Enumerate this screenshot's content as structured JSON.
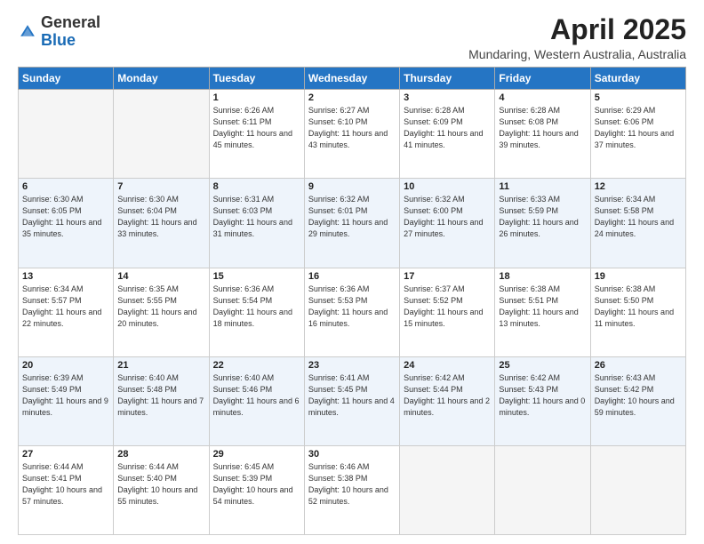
{
  "logo": {
    "general": "General",
    "blue": "Blue"
  },
  "header": {
    "month": "April 2025",
    "location": "Mundaring, Western Australia, Australia"
  },
  "weekdays": [
    "Sunday",
    "Monday",
    "Tuesday",
    "Wednesday",
    "Thursday",
    "Friday",
    "Saturday"
  ],
  "weeks": [
    [
      {
        "day": "",
        "info": ""
      },
      {
        "day": "",
        "info": ""
      },
      {
        "day": "1",
        "info": "Sunrise: 6:26 AM\nSunset: 6:11 PM\nDaylight: 11 hours and 45 minutes."
      },
      {
        "day": "2",
        "info": "Sunrise: 6:27 AM\nSunset: 6:10 PM\nDaylight: 11 hours and 43 minutes."
      },
      {
        "day": "3",
        "info": "Sunrise: 6:28 AM\nSunset: 6:09 PM\nDaylight: 11 hours and 41 minutes."
      },
      {
        "day": "4",
        "info": "Sunrise: 6:28 AM\nSunset: 6:08 PM\nDaylight: 11 hours and 39 minutes."
      },
      {
        "day": "5",
        "info": "Sunrise: 6:29 AM\nSunset: 6:06 PM\nDaylight: 11 hours and 37 minutes."
      }
    ],
    [
      {
        "day": "6",
        "info": "Sunrise: 6:30 AM\nSunset: 6:05 PM\nDaylight: 11 hours and 35 minutes."
      },
      {
        "day": "7",
        "info": "Sunrise: 6:30 AM\nSunset: 6:04 PM\nDaylight: 11 hours and 33 minutes."
      },
      {
        "day": "8",
        "info": "Sunrise: 6:31 AM\nSunset: 6:03 PM\nDaylight: 11 hours and 31 minutes."
      },
      {
        "day": "9",
        "info": "Sunrise: 6:32 AM\nSunset: 6:01 PM\nDaylight: 11 hours and 29 minutes."
      },
      {
        "day": "10",
        "info": "Sunrise: 6:32 AM\nSunset: 6:00 PM\nDaylight: 11 hours and 27 minutes."
      },
      {
        "day": "11",
        "info": "Sunrise: 6:33 AM\nSunset: 5:59 PM\nDaylight: 11 hours and 26 minutes."
      },
      {
        "day": "12",
        "info": "Sunrise: 6:34 AM\nSunset: 5:58 PM\nDaylight: 11 hours and 24 minutes."
      }
    ],
    [
      {
        "day": "13",
        "info": "Sunrise: 6:34 AM\nSunset: 5:57 PM\nDaylight: 11 hours and 22 minutes."
      },
      {
        "day": "14",
        "info": "Sunrise: 6:35 AM\nSunset: 5:55 PM\nDaylight: 11 hours and 20 minutes."
      },
      {
        "day": "15",
        "info": "Sunrise: 6:36 AM\nSunset: 5:54 PM\nDaylight: 11 hours and 18 minutes."
      },
      {
        "day": "16",
        "info": "Sunrise: 6:36 AM\nSunset: 5:53 PM\nDaylight: 11 hours and 16 minutes."
      },
      {
        "day": "17",
        "info": "Sunrise: 6:37 AM\nSunset: 5:52 PM\nDaylight: 11 hours and 15 minutes."
      },
      {
        "day": "18",
        "info": "Sunrise: 6:38 AM\nSunset: 5:51 PM\nDaylight: 11 hours and 13 minutes."
      },
      {
        "day": "19",
        "info": "Sunrise: 6:38 AM\nSunset: 5:50 PM\nDaylight: 11 hours and 11 minutes."
      }
    ],
    [
      {
        "day": "20",
        "info": "Sunrise: 6:39 AM\nSunset: 5:49 PM\nDaylight: 11 hours and 9 minutes."
      },
      {
        "day": "21",
        "info": "Sunrise: 6:40 AM\nSunset: 5:48 PM\nDaylight: 11 hours and 7 minutes."
      },
      {
        "day": "22",
        "info": "Sunrise: 6:40 AM\nSunset: 5:46 PM\nDaylight: 11 hours and 6 minutes."
      },
      {
        "day": "23",
        "info": "Sunrise: 6:41 AM\nSunset: 5:45 PM\nDaylight: 11 hours and 4 minutes."
      },
      {
        "day": "24",
        "info": "Sunrise: 6:42 AM\nSunset: 5:44 PM\nDaylight: 11 hours and 2 minutes."
      },
      {
        "day": "25",
        "info": "Sunrise: 6:42 AM\nSunset: 5:43 PM\nDaylight: 11 hours and 0 minutes."
      },
      {
        "day": "26",
        "info": "Sunrise: 6:43 AM\nSunset: 5:42 PM\nDaylight: 10 hours and 59 minutes."
      }
    ],
    [
      {
        "day": "27",
        "info": "Sunrise: 6:44 AM\nSunset: 5:41 PM\nDaylight: 10 hours and 57 minutes."
      },
      {
        "day": "28",
        "info": "Sunrise: 6:44 AM\nSunset: 5:40 PM\nDaylight: 10 hours and 55 minutes."
      },
      {
        "day": "29",
        "info": "Sunrise: 6:45 AM\nSunset: 5:39 PM\nDaylight: 10 hours and 54 minutes."
      },
      {
        "day": "30",
        "info": "Sunrise: 6:46 AM\nSunset: 5:38 PM\nDaylight: 10 hours and 52 minutes."
      },
      {
        "day": "",
        "info": ""
      },
      {
        "day": "",
        "info": ""
      },
      {
        "day": "",
        "info": ""
      }
    ]
  ]
}
